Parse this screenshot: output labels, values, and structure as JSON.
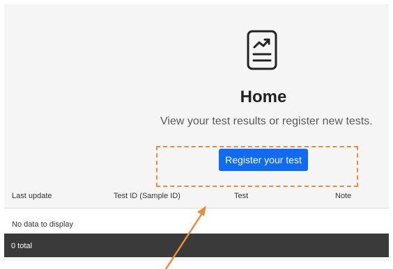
{
  "home": {
    "title": "Home",
    "subtitle": "View your test results or register new tests.",
    "register_button_label": "Register your test",
    "icon": "chart-document-icon"
  },
  "table": {
    "columns": [
      "Last update",
      "Test ID (Sample ID)",
      "Test",
      "Note"
    ],
    "empty_message": "No data to display",
    "footer_total": "0 total"
  },
  "annotation": {
    "highlight_color": "#ee8a3a",
    "arrow_color": "#ee8a3a"
  },
  "colors": {
    "accent": "#0f6cf2",
    "footer_bg": "#3a3a3a",
    "panel_bg": "#f5f5f5"
  }
}
